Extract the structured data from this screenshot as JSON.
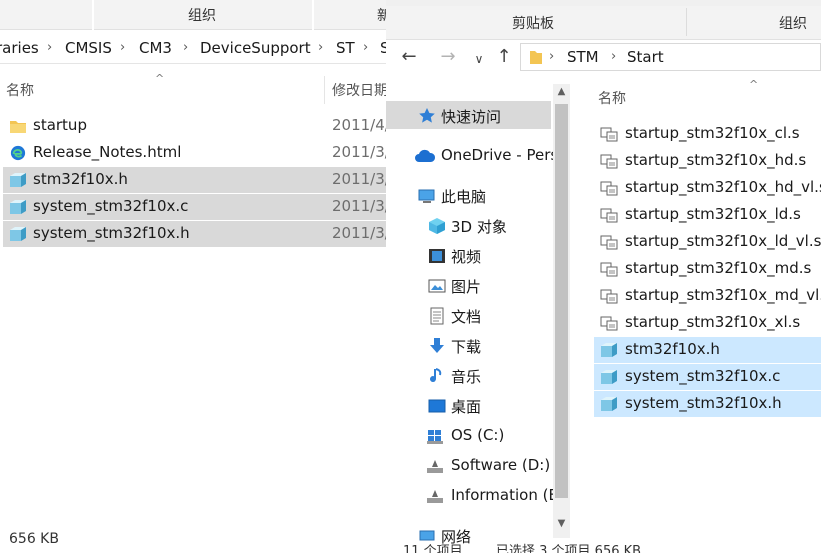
{
  "left_window": {
    "ribbon": {
      "group_label": "组织",
      "new_partial": "新"
    },
    "breadcrumb": [
      "raries",
      "CMSIS",
      "CM3",
      "DeviceSupport",
      "ST",
      "S"
    ],
    "columns": {
      "name": "名称",
      "date_modified": "修改日期"
    },
    "files": [
      {
        "name": "startup",
        "date": "2011/4/",
        "icon": "folder-icon",
        "selected": false
      },
      {
        "name": "Release_Notes.html",
        "date": "2011/3/",
        "icon": "edge-html-icon",
        "selected": false
      },
      {
        "name": "stm32f10x.h",
        "date": "2011/3/",
        "icon": "source-file-icon",
        "selected": true
      },
      {
        "name": "system_stm32f10x.c",
        "date": "2011/3/",
        "icon": "source-file-icon",
        "selected": true
      },
      {
        "name": "system_stm32f10x.h",
        "date": "2011/3/",
        "icon": "source-file-icon",
        "selected": true
      }
    ],
    "status": "656 KB"
  },
  "right_window": {
    "ribbon": {
      "clipboard_label": "剪贴板",
      "organize_label": "组织"
    },
    "nav_buttons": {
      "back": "←",
      "forward": "→",
      "recent": "∨",
      "up": "↑"
    },
    "breadcrumb": [
      "STM",
      "Start"
    ],
    "nav_pane": [
      {
        "label": "快速访问",
        "icon": "quick-access-star-icon",
        "level": 0,
        "selected": true
      },
      {
        "label": "OneDrive - Pers",
        "icon": "onedrive-cloud-icon",
        "level": 0,
        "selected": false
      },
      {
        "label": "此电脑",
        "icon": "this-pc-icon",
        "level": 0,
        "selected": false
      },
      {
        "label": "3D 对象",
        "icon": "3d-objects-icon",
        "level": 1,
        "selected": false
      },
      {
        "label": "视频",
        "icon": "videos-icon",
        "level": 1,
        "selected": false
      },
      {
        "label": "图片",
        "icon": "pictures-icon",
        "level": 1,
        "selected": false
      },
      {
        "label": "文档",
        "icon": "documents-icon",
        "level": 1,
        "selected": false
      },
      {
        "label": "下载",
        "icon": "downloads-icon",
        "level": 1,
        "selected": false
      },
      {
        "label": "音乐",
        "icon": "music-icon",
        "level": 1,
        "selected": false
      },
      {
        "label": "桌面",
        "icon": "desktop-icon",
        "level": 1,
        "selected": false
      },
      {
        "label": "OS (C:)",
        "icon": "windows-drive-icon",
        "level": 1,
        "selected": false
      },
      {
        "label": "Software (D:)",
        "icon": "drive-icon",
        "level": 1,
        "selected": false
      },
      {
        "label": "Information (E",
        "icon": "drive-icon",
        "level": 1,
        "selected": false
      },
      {
        "label": "网络",
        "icon": "network-icon",
        "level": 0,
        "selected": false
      }
    ],
    "column_name": "名称",
    "files": [
      {
        "name": "startup_stm32f10x_cl.s",
        "icon": "asm-file-icon",
        "selected": false
      },
      {
        "name": "startup_stm32f10x_hd.s",
        "icon": "asm-file-icon",
        "selected": false
      },
      {
        "name": "startup_stm32f10x_hd_vl.s",
        "icon": "asm-file-icon",
        "selected": false
      },
      {
        "name": "startup_stm32f10x_ld.s",
        "icon": "asm-file-icon",
        "selected": false
      },
      {
        "name": "startup_stm32f10x_ld_vl.s",
        "icon": "asm-file-icon",
        "selected": false
      },
      {
        "name": "startup_stm32f10x_md.s",
        "icon": "asm-file-icon",
        "selected": false
      },
      {
        "name": "startup_stm32f10x_md_vl.s",
        "icon": "asm-file-icon",
        "selected": false
      },
      {
        "name": "startup_stm32f10x_xl.s",
        "icon": "asm-file-icon",
        "selected": false
      },
      {
        "name": "stm32f10x.h",
        "icon": "source-file-icon",
        "selected": true
      },
      {
        "name": "system_stm32f10x.c",
        "icon": "source-file-icon",
        "selected": true
      },
      {
        "name": "system_stm32f10x.h",
        "icon": "source-file-icon",
        "selected": true
      }
    ],
    "status": {
      "item_count": "11 个项目",
      "selection": "已选择 3 个项目 656 KB"
    }
  },
  "colors": {
    "selection_gray": "#d9d9d9",
    "selection_blue": "#cce8ff",
    "folder_yellow": "#f3c553",
    "accent_blue": "#1e78d7"
  }
}
